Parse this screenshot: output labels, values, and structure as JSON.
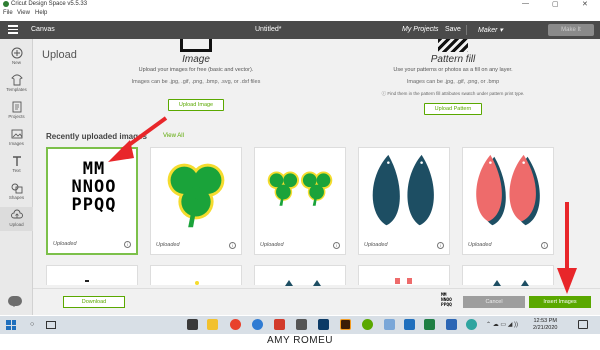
{
  "window": {
    "title": "Cricut Design Space  v5.5.33",
    "controls": [
      "—",
      "▢",
      "✕"
    ]
  },
  "menu": [
    "File",
    "View",
    "Help"
  ],
  "header": {
    "canvas_label": "Canvas",
    "document_title": "Untitled*",
    "my_projects": "My Projects",
    "save": "Save",
    "machine": "Maker",
    "make_it": "Make It"
  },
  "sidebar": {
    "items": [
      {
        "label": "New",
        "icon": "plus-circle-icon"
      },
      {
        "label": "Templates",
        "icon": "shirt-icon"
      },
      {
        "label": "Projects",
        "icon": "projects-icon"
      },
      {
        "label": "Images",
        "icon": "image-icon"
      },
      {
        "label": "Text",
        "icon": "text-icon"
      },
      {
        "label": "Shapes",
        "icon": "shapes-icon"
      },
      {
        "label": "Upload",
        "icon": "cloud-upload-icon"
      }
    ],
    "active": "Upload"
  },
  "upload": {
    "page_title": "Upload",
    "image": {
      "title": "Image",
      "subtitle": "Upload your images for free (basic and vector).",
      "formats": "Images can be .jpg, .gif, .png, .bmp, .svg, or .dxf files",
      "button": "Upload Image"
    },
    "pattern": {
      "title": "Pattern fill",
      "subtitle": "Use your patterns or photos as a fill on any layer.",
      "formats": "Images can be .jpg, .gif, .png, or .bmp",
      "note": "ⓘ Find them in the pattern fill attributes swatch under pattern print type.",
      "button": "Upload Pattern"
    },
    "recent_title": "Recently uploaded images",
    "view_all": "View All",
    "cards": [
      {
        "label": "Uploaded",
        "content": "MM\nNNOO\nPPQQ",
        "selected": true
      },
      {
        "label": "Uploaded",
        "content": "shamrock",
        "selected": false
      },
      {
        "label": "Uploaded",
        "content": "two-shamrocks",
        "selected": false
      },
      {
        "label": "Uploaded",
        "content": "blue-teardrops",
        "selected": false
      },
      {
        "label": "Uploaded",
        "content": "coral-teardrops",
        "selected": false
      }
    ]
  },
  "bottom": {
    "download": "Download",
    "mini_preview": "MM\nNNOO\nPPQQ",
    "cancel": "Cancel",
    "insert": "Insert Images"
  },
  "taskbar": {
    "time": "12:53 PM",
    "date": "2/21/2020"
  },
  "watermark": "AMY ROMEU",
  "colors": {
    "header_bg": "#4a4a4a",
    "accent_green": "#5aa800",
    "arrow_red": "#e8262a",
    "teardrop_blue": "#1d4e63",
    "teardrop_coral": "#ee6b6b",
    "shamrock_green": "#1aa33a",
    "shamrock_yellow": "#f5dc2e"
  }
}
